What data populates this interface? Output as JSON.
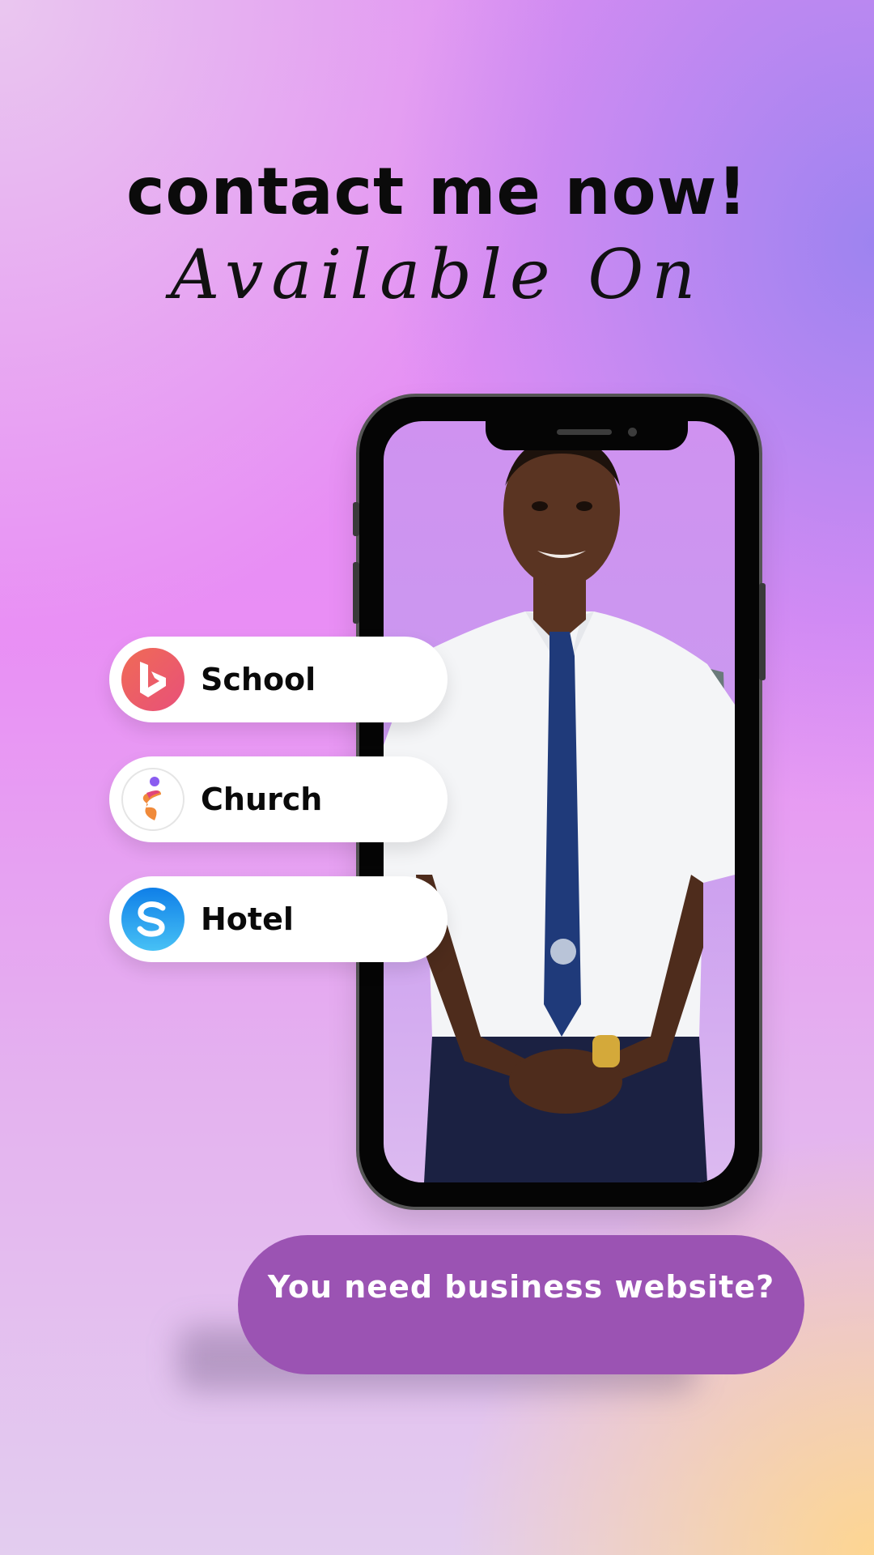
{
  "headline": "contact me now!",
  "subheadline": "Available On",
  "options": [
    {
      "label": "School",
      "icon": "bing-logo-icon",
      "color": "#ea5f4d"
    },
    {
      "label": "Church",
      "icon": "flame-figure-icon",
      "color": "#8a5cf0"
    },
    {
      "label": "Hotel",
      "icon": "skype-s-icon",
      "color": "#1a8cf0"
    }
  ],
  "cta": {
    "label": "You need business website?"
  },
  "colors": {
    "accent": "#9b53b3",
    "background_top": "#e08ef2",
    "background_corner": "#ffd68c"
  }
}
